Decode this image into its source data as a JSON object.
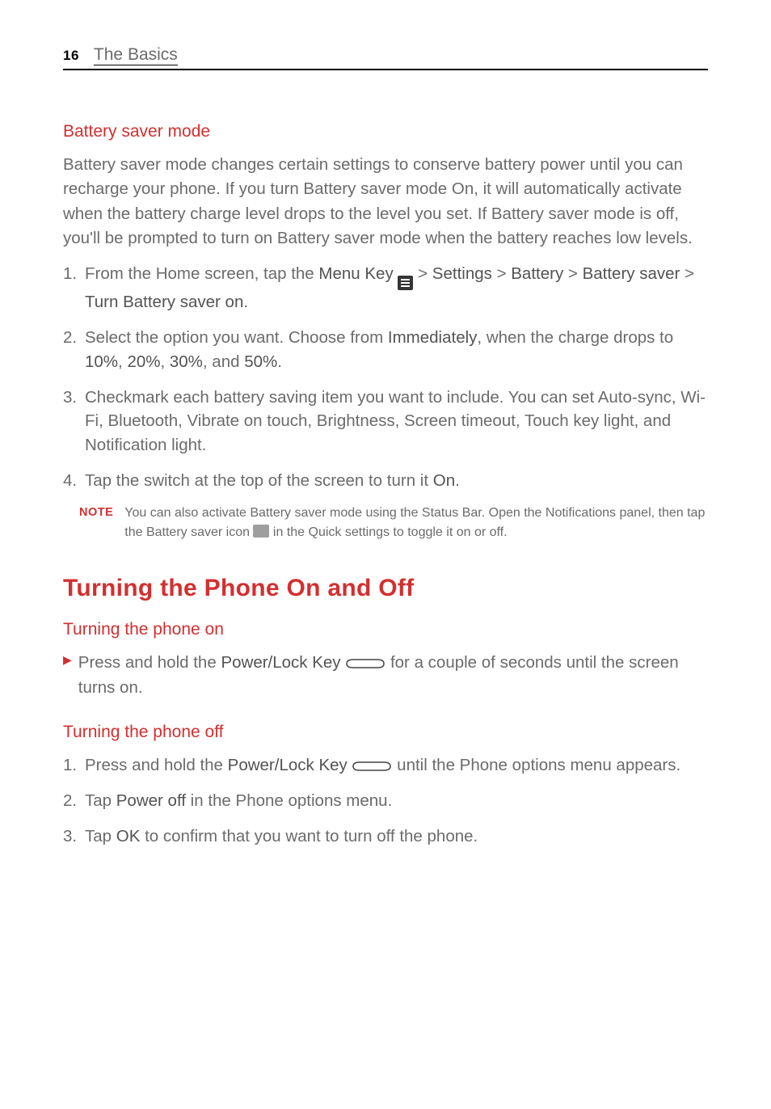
{
  "header": {
    "page_number": "16",
    "chapter_title": "The Basics"
  },
  "sections": {
    "battery_saver": {
      "title": "Battery saver mode",
      "intro": "Battery saver mode changes certain settings to conserve battery power until you can recharge your phone. If you turn Battery saver mode On, it will automatically activate when the battery charge level drops to the level you set. If Battery saver mode is off, you'll be prompted to turn on Battery saver mode when the battery reaches low levels.",
      "step1_a": "From the Home screen, tap the ",
      "step1_menu_key": "Menu Key",
      "step1_b": " > ",
      "step1_settings": "Settings",
      "step1_c": " > ",
      "step1_battery": "Battery",
      "step1_d": " > ",
      "step1_battery_saver": "Battery saver",
      "step1_e": " > ",
      "step1_turn_on": "Turn Battery saver on",
      "step1_period": ".",
      "step2_a": "Select the option you want. Choose from ",
      "step2_immediately": "Immediately",
      "step2_b": ", when the charge drops to ",
      "step2_10": "10%",
      "step2_c1": ", ",
      "step2_20": "20%",
      "step2_c2": ", ",
      "step2_30": "30%",
      "step2_c3": ", and ",
      "step2_50": "50%",
      "step2_d": ".",
      "step3": "Checkmark each battery saving item you want to include. You can set Auto-sync, Wi-Fi, Bluetooth, Vibrate on touch, Brightness, Screen timeout, Touch key light, and Notification light.",
      "step4_a": "Tap the switch at the top of the screen to turn it ",
      "step4_on": "On",
      "step4_b": ".",
      "note_label": "NOTE",
      "note_a": "You can also activate Battery saver mode using the Status Bar. Open the Notifications panel, then tap the Battery saver icon ",
      "note_b": " in the Quick settings to toggle it on or off."
    },
    "turning": {
      "heading": "Turning the Phone On and Off",
      "on_title": "Turning the phone on",
      "on_a": "Press and hold the ",
      "on_key": "Power/Lock Key",
      "on_b": " for a couple of seconds until the screen turns on.",
      "off_title": "Turning the phone off",
      "off1_a": "Press and hold the ",
      "off1_key": "Power/Lock Key",
      "off1_b": " until the Phone options menu appears.",
      "off2_a": "Tap ",
      "off2_power_off": "Power off",
      "off2_b": " in the Phone options menu.",
      "off3_a": "Tap ",
      "off3_ok": "OK",
      "off3_b": " to confirm that you want to turn off the phone."
    }
  }
}
